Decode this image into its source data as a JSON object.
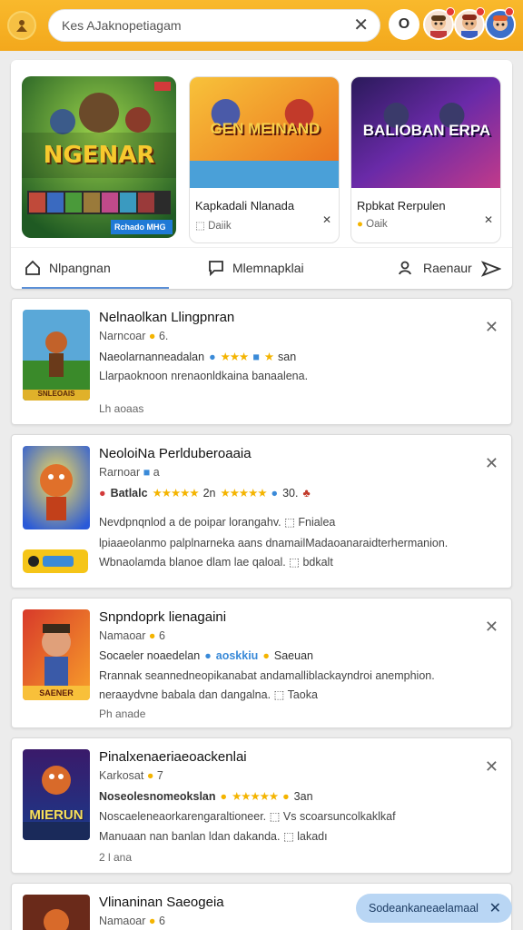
{
  "header": {
    "search_value": "Kes AJaknopetiagam",
    "clear_glyph": "✕",
    "avatar_label": "O"
  },
  "featured": [
    {
      "art_title": "NGENAR",
      "art_sub": "Rchado MHG"
    },
    {
      "art_title": "GEN MEINAND",
      "title": "Kapkadali Nlanada",
      "sub": "Daiik",
      "x": "✕"
    },
    {
      "art_title": "BALIOBAN ERPA",
      "title": "Rpbkat Rerpulen",
      "sub": "Oaik",
      "x": "✕"
    }
  ],
  "tabs": [
    {
      "label": "Nlpangnan"
    },
    {
      "label": "Mlemnapklai"
    },
    {
      "label": "Raenaur"
    }
  ],
  "posts": [
    {
      "title": "Nelnaolkan Llingpnran",
      "author": "Narncoar",
      "author_num": "6.",
      "meta": "Naeolarnanneadalan",
      "meta_tail": "san",
      "body1": "Llarpaoknoon nrenaonldkaina banaalena.",
      "foot": "Lh aoaas",
      "thumb": "SNLEOAIS"
    },
    {
      "title": "NeoloiNa Perlduberoaaia",
      "author": "Rarnoar",
      "author_num": "a",
      "meta": "Batlalc",
      "meta_mid": "2n",
      "meta_tail": "30.",
      "body1": "Nevdpnqnlod a de poipar lorangahv. ⬚ Fnialea",
      "body2": "lpiaaeolanmo palplnarneka aans dnamailMadaoanaraidterhermanion.",
      "body3": "Wbnaolamda blanoe dlam lae qaloal. ⬚ bdkalt",
      "thumb": ""
    },
    {
      "title": "Snpndoprk lienagaini",
      "author": "Namaoar",
      "author_num": "6",
      "meta": "Socaeler noaedelan",
      "meta_mid": "aoskkiu",
      "meta_tail": "Saeuan",
      "body1": "Rrannak seannedneopikanabat andamalliblackayndroi anemphion.",
      "body2": "neraaydvne babala dan dangalna. ⬚ Taoka",
      "foot": "Ph anade",
      "thumb": "SAENER"
    },
    {
      "title": "Pinalxenaeriaeoackenlai",
      "author": "Karkosat",
      "author_num": "7",
      "meta": "Noseolesnomeokslan",
      "meta_tail": "3an",
      "body1": "Noscaeleneaorkarengaraltioneer. ⬚ Vs scoarsuncolkaklkaf",
      "body2": "Manuaan nan banlan ldan dakanda. ⬚ lakadı",
      "foot": "2 l ana",
      "thumb": "MIERUN"
    },
    {
      "title": "Vlinaninan Saeogeia",
      "author": "Namaoar",
      "author_num": "6",
      "thumb": ""
    }
  ],
  "toast": {
    "label": "Sodeankaneaelamaal",
    "close": "✕"
  },
  "colors": {
    "topbar": "#f3a81c",
    "tab_accent": "#5b8fd6",
    "star": "#f4b400",
    "toast_bg": "#b9d6f4"
  }
}
